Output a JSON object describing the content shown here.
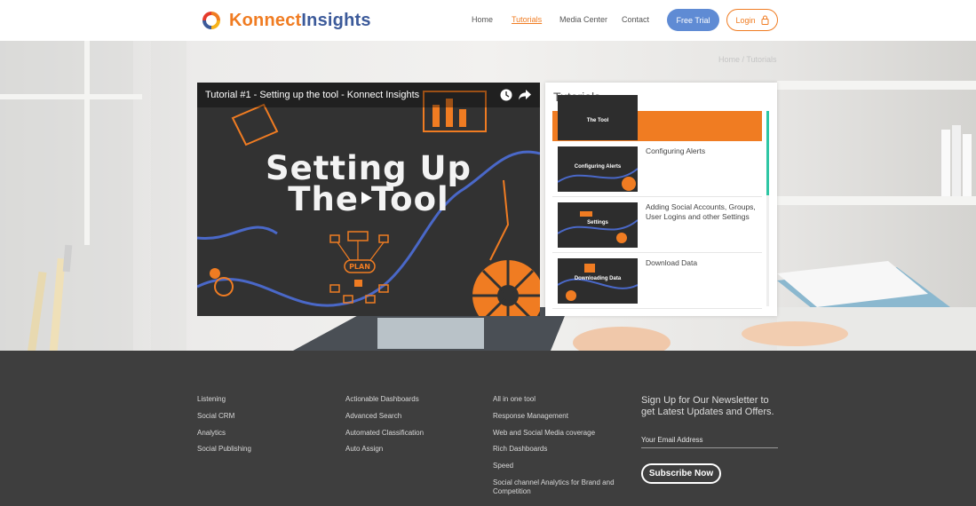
{
  "header": {
    "brand_part1": "Konnect",
    "brand_part2": "Insights",
    "nav": [
      {
        "label": "Home"
      },
      {
        "label": "Tutorials"
      },
      {
        "label": "Media Center"
      },
      {
        "label": "Contact"
      }
    ],
    "free_trial_label": "Free Trial",
    "login_label": "Login"
  },
  "breadcrumb": "Home / Tutorials",
  "video": {
    "title": "Tutorial #1 - Setting up the tool - Konnect Insights",
    "overlay_line1": "Setting Up",
    "overlay_line2": "The Tool",
    "plan_label": "PLAN"
  },
  "tutorials": {
    "heading": "Tutorials",
    "items": [
      {
        "label": "",
        "thumb_text": "The Tool"
      },
      {
        "label": "Configuring Alerts",
        "thumb_text": "Configuring Alerts"
      },
      {
        "label": "Adding Social Accounts, Groups, User Logins and other Settings",
        "thumb_text": "Settings"
      },
      {
        "label": "Download Data",
        "thumb_text": "Downloading Data"
      }
    ]
  },
  "footer": {
    "col1": [
      "Listening",
      "Social CRM",
      "Analytics",
      "Social Publishing"
    ],
    "col2": [
      "Actionable Dashboards",
      "Advanced Search",
      "Automated Classification",
      "Auto Assign"
    ],
    "col3": [
      "All in one tool",
      "Response Management",
      "Web and Social Media coverage",
      "Rich Dashboards",
      "Speed",
      "Social channel Analytics for Brand and",
      "Competition"
    ],
    "newsletter_title": "Sign Up for Our Newsletter to get Latest Updates and Offers.",
    "email_placeholder": "Your Email Address",
    "subscribe_label": "Subscribe Now"
  },
  "colors": {
    "accent_orange": "#f07c22",
    "brand_blue": "#3c5a9a",
    "trial_blue": "#5f8bd4",
    "footer_bg": "#3e3e3e",
    "scroll_green": "#2ec6a4"
  }
}
